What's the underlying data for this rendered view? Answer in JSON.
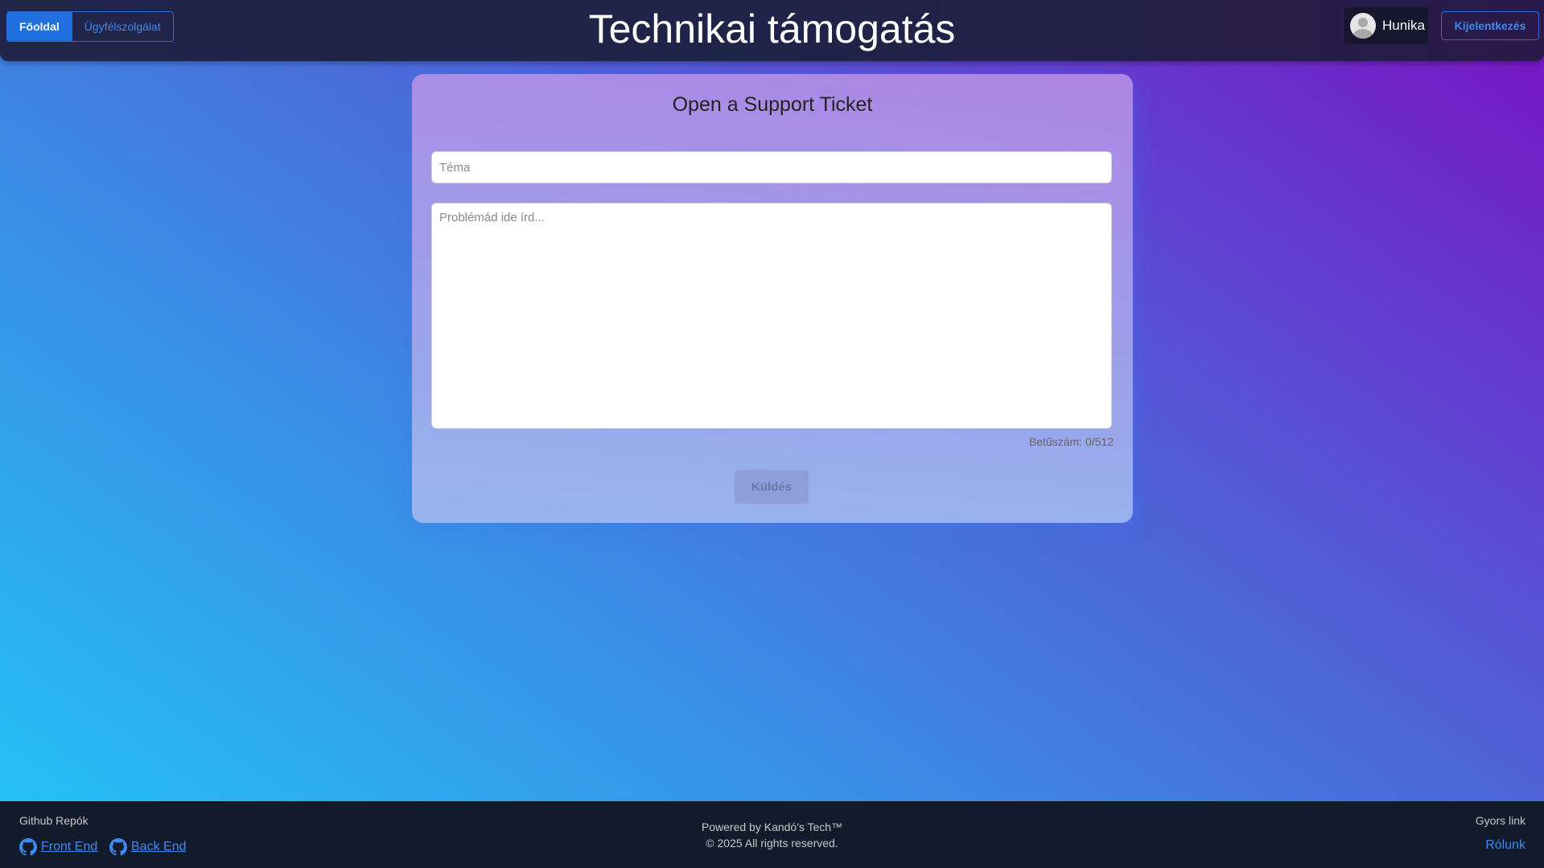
{
  "header": {
    "nav": [
      {
        "label": "Főoldal",
        "active": true
      },
      {
        "label": "Ügyfélszolgálat",
        "active": false
      }
    ],
    "title": "Technikai támogatás",
    "user": {
      "name": "Hunika",
      "avatar_icon": "user-avatar-icon"
    },
    "logout_label": "Kijelentkezés"
  },
  "form": {
    "title": "Open a Support Ticket",
    "subject_placeholder": "Téma",
    "subject_value": "",
    "problem_placeholder": "Problémád ide írd...",
    "problem_value": "",
    "char_count": "Betűszám: 0/512",
    "submit_label": "Küldés"
  },
  "footer": {
    "repos_title": "Github Repók",
    "repos": [
      {
        "label": "Front End",
        "icon": "github-icon"
      },
      {
        "label": "Back End",
        "icon": "github-icon"
      }
    ],
    "powered_by": "Powered by Kandó's Tech™",
    "copyright": "© 2025 All rights reserved.",
    "quick_links_title": "Gyors link",
    "about_label": "Rólunk"
  },
  "colors": {
    "accent": "#1f6fde",
    "link": "#3d8af0",
    "header_bg": "#22254a",
    "footer_bg": "#121b2c"
  }
}
